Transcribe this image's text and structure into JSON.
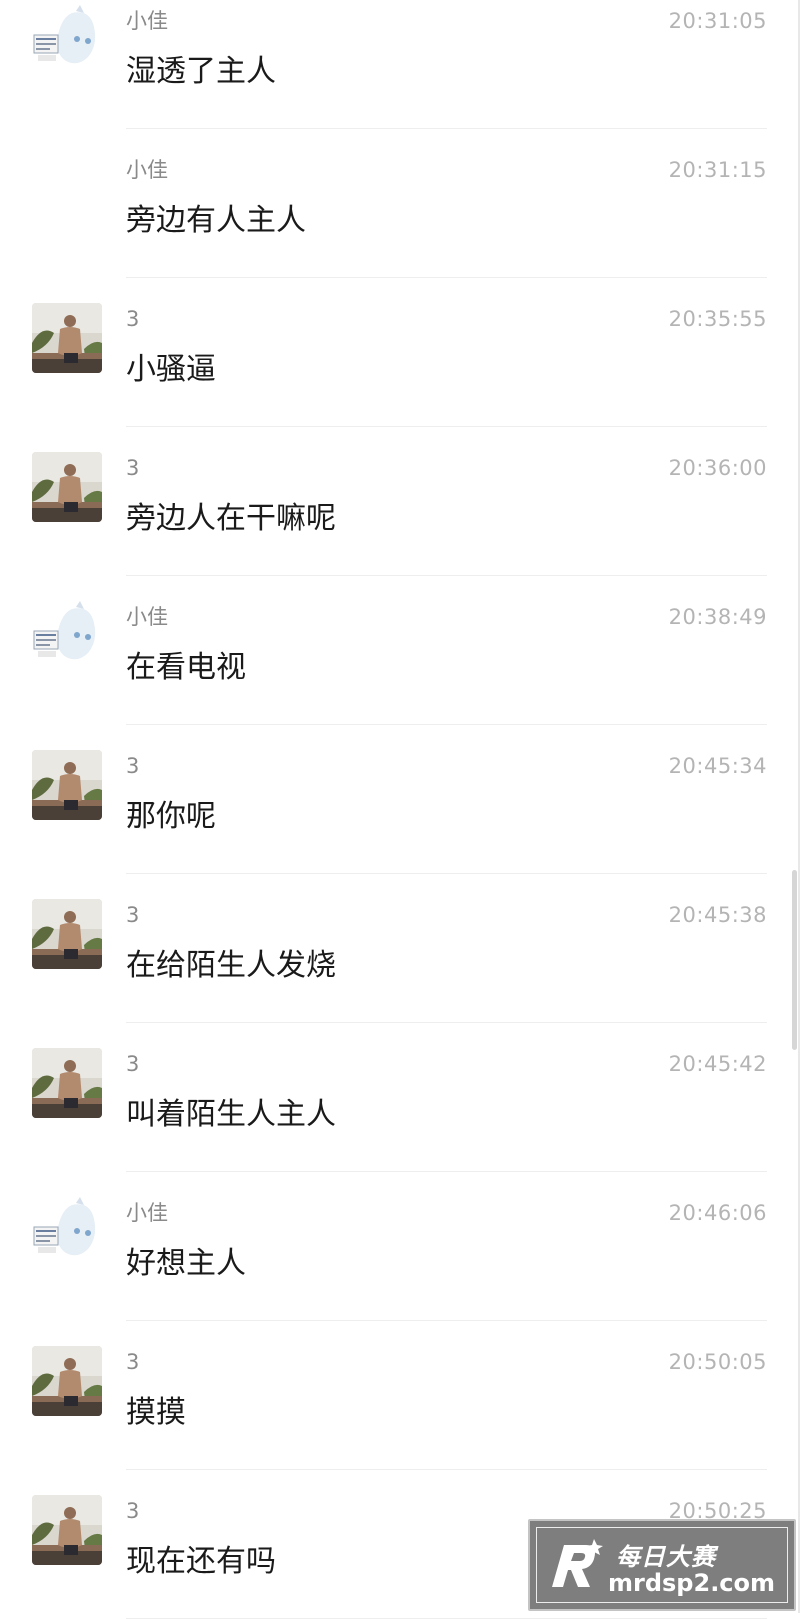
{
  "messages": [
    {
      "sender": "小佳",
      "time": "20:31:05",
      "text": "湿透了主人",
      "avatar": "xiaojia"
    },
    {
      "sender": "小佳",
      "time": "20:31:15",
      "text": "旁边有人主人",
      "avatar": "none"
    },
    {
      "sender": "3",
      "time": "20:35:55",
      "text": "小骚逼",
      "avatar": "user3"
    },
    {
      "sender": "3",
      "time": "20:36:00",
      "text": "旁边人在干嘛呢",
      "avatar": "user3"
    },
    {
      "sender": "小佳",
      "time": "20:38:49",
      "text": "在看电视",
      "avatar": "xiaojia"
    },
    {
      "sender": "3",
      "time": "20:45:34",
      "text": "那你呢",
      "avatar": "user3"
    },
    {
      "sender": "3",
      "time": "20:45:38",
      "text": "在给陌生人发烧",
      "avatar": "user3"
    },
    {
      "sender": "3",
      "time": "20:45:42",
      "text": "叫着陌生人主人",
      "avatar": "user3"
    },
    {
      "sender": "小佳",
      "time": "20:46:06",
      "text": "好想主人",
      "avatar": "xiaojia"
    },
    {
      "sender": "3",
      "time": "20:50:05",
      "text": "摸摸",
      "avatar": "user3"
    },
    {
      "sender": "3",
      "time": "20:50:25",
      "text": "现在还有吗",
      "avatar": "user3"
    }
  ],
  "watermark": {
    "title": "每日大赛",
    "url": "mrdsp2.com"
  },
  "colors": {
    "name": "#8a8a8a",
    "time": "#b4b4b4",
    "message": "#1a1a1a",
    "divider": "#eeeeee"
  }
}
